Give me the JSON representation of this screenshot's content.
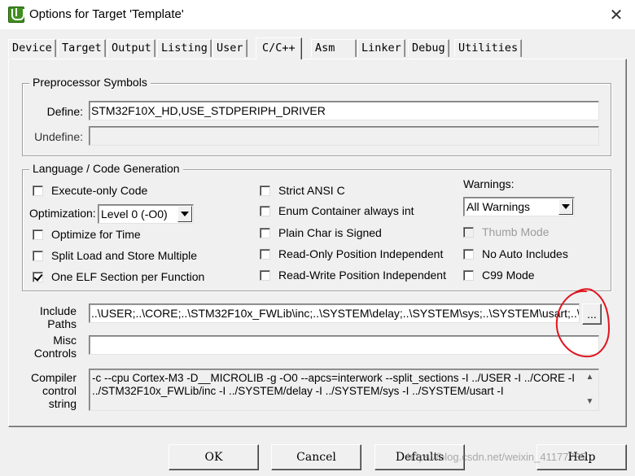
{
  "window": {
    "title": "Options for Target 'Template'",
    "close_icon": "close-icon",
    "app_icon": "keil-uvision-icon"
  },
  "tabs": [
    {
      "label": "Device"
    },
    {
      "label": "Target"
    },
    {
      "label": "Output"
    },
    {
      "label": "Listing"
    },
    {
      "label": "User"
    },
    {
      "label": "C/C++",
      "active": true
    },
    {
      "label": "Asm"
    },
    {
      "label": "Linker"
    },
    {
      "label": "Debug"
    },
    {
      "label": "Utilities"
    }
  ],
  "preprocessor": {
    "group_label": "Preprocessor Symbols",
    "define_label": "Define:",
    "define_value": "STM32F10X_HD,USE_STDPERIPH_DRIVER",
    "undefine_label": "Undefine:",
    "undefine_value": ""
  },
  "language": {
    "group_label": "Language / Code Generation",
    "execute_only": {
      "label": "Execute-only Code",
      "checked": false
    },
    "optimization_label": "Optimization:",
    "optimization_value": "Level 0 (-O0)",
    "optimize_time": {
      "label": "Optimize for Time",
      "checked": false
    },
    "split_load": {
      "label": "Split Load and Store Multiple",
      "checked": false
    },
    "one_elf": {
      "label": "One ELF Section per Function",
      "checked": true
    },
    "strict_ansi": {
      "label": "Strict ANSI C",
      "checked": false
    },
    "enum_container": {
      "label": "Enum Container always int",
      "checked": false
    },
    "plain_char": {
      "label": "Plain Char is Signed",
      "checked": false
    },
    "ro_position": {
      "label": "Read-Only Position Independent",
      "checked": false
    },
    "rw_position": {
      "label": "Read-Write Position Independent",
      "checked": false
    },
    "warnings_label": "Warnings:",
    "warnings_value": "All Warnings",
    "thumb_mode": {
      "label": "Thumb Mode",
      "checked": false,
      "disabled": true
    },
    "no_auto_includes": {
      "label": "No Auto Includes",
      "checked": false
    },
    "c99_mode": {
      "label": "C99 Mode",
      "checked": false
    }
  },
  "include_paths": {
    "label_line1": "Include",
    "label_line2": "Paths",
    "value": "..\\USER;..\\CORE;..\\STM32F10x_FWLib\\inc;..\\SYSTEM\\delay;..\\SYSTEM\\sys;..\\SYSTEM\\usart;..\\",
    "browse_label": "..."
  },
  "misc_controls": {
    "label_line1": "Misc",
    "label_line2": "Controls",
    "value": ""
  },
  "compiler_string": {
    "label_line1": "Compiler",
    "label_line2": "control",
    "label_line3": "string",
    "line1": "-c --cpu Cortex-M3 -D__MICROLIB -g -O0 --apcs=interwork --split_sections -I ../USER -I ../CORE -I",
    "line2": "../STM32F10x_FWLib/inc -I ../SYSTEM/delay -I ../SYSTEM/sys -I ../SYSTEM/usart -I"
  },
  "buttons": {
    "ok": "OK",
    "cancel": "Cancel",
    "defaults": "Defaults",
    "help": "Help"
  },
  "watermark": "https://blog.csdn.net/weixin_41177735",
  "annotation_color": "#e0141e"
}
